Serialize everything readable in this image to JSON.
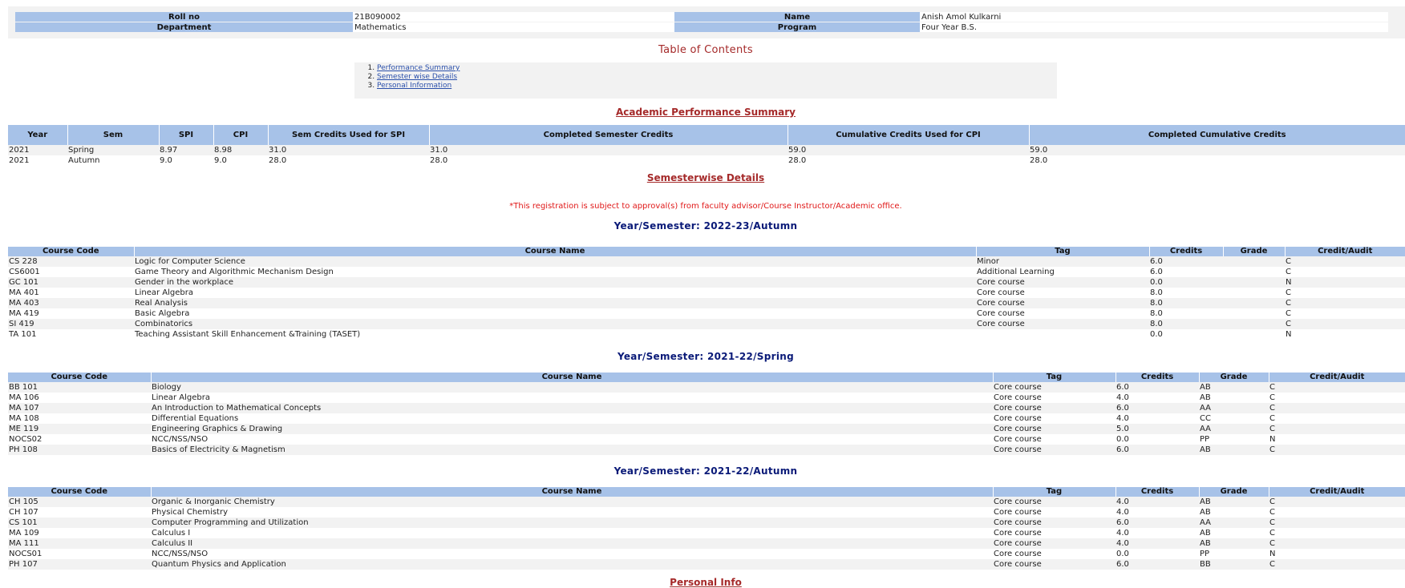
{
  "student": {
    "roll_label": "Roll no",
    "roll_value": "21B090002",
    "name_label": "Name",
    "name_value": "Anish Amol Kulkarni",
    "dept_label": "Department",
    "dept_value": "Mathematics",
    "program_label": "Program",
    "program_value": "Four Year B.S."
  },
  "toc": {
    "title": "Table of Contents",
    "items": [
      "Performance Summary",
      "Semester wise Details",
      "Personal Information"
    ]
  },
  "performance": {
    "title": "Academic Performance Summary",
    "headers": [
      "Year",
      "Sem",
      "SPI",
      "CPI",
      "Sem Credits Used for SPI",
      "Completed Semester Credits",
      "Cumulative Credits Used for CPI",
      "Completed Cumulative Credits"
    ],
    "rows": [
      [
        "2021",
        "Spring",
        "8.97",
        "8.98",
        "31.0",
        "31.0",
        "59.0",
        "59.0"
      ],
      [
        "2021",
        "Autumn",
        "9.0",
        "9.0",
        "28.0",
        "28.0",
        "28.0",
        "28.0"
      ]
    ]
  },
  "semesterwise": {
    "title": "Semesterwise Details",
    "note": "*This registration is subject to approval(s) from faculty advisor/Course Instructor/Academic office.",
    "headers": [
      "Course Code",
      "Course Name",
      "Tag",
      "Credits",
      "Grade",
      "Credit/Audit"
    ],
    "semesters": [
      {
        "title": "Year/Semester: 2022-23/Autumn",
        "rows": [
          [
            "CS 228",
            "Logic for Computer Science",
            "Minor",
            "6.0",
            "",
            "C"
          ],
          [
            "CS6001",
            "Game Theory and Algorithmic Mechanism Design",
            "Additional Learning",
            "6.0",
            "",
            "C"
          ],
          [
            "GC 101",
            "Gender in the workplace",
            "Core course",
            "0.0",
            "",
            "N"
          ],
          [
            "MA 401",
            "Linear Algebra",
            "Core course",
            "8.0",
            "",
            "C"
          ],
          [
            "MA 403",
            "Real Analysis",
            "Core course",
            "8.0",
            "",
            "C"
          ],
          [
            "MA 419",
            "Basic Algebra",
            "Core course",
            "8.0",
            "",
            "C"
          ],
          [
            "SI 419",
            "Combinatorics",
            "Core course",
            "8.0",
            "",
            "C"
          ],
          [
            "TA 101",
            "Teaching Assistant Skill Enhancement &Training (TASET)",
            "",
            "0.0",
            "",
            "N"
          ]
        ]
      },
      {
        "title": "Year/Semester: 2021-22/Spring",
        "rows": [
          [
            "BB 101",
            "Biology",
            "Core course",
            "6.0",
            "AB",
            "C"
          ],
          [
            "MA 106",
            "Linear Algebra",
            "Core course",
            "4.0",
            "AB",
            "C"
          ],
          [
            "MA 107",
            "An Introduction to Mathematical Concepts",
            "Core course",
            "6.0",
            "AA",
            "C"
          ],
          [
            "MA 108",
            "Differential Equations",
            "Core course",
            "4.0",
            "CC",
            "C"
          ],
          [
            "ME 119",
            "Engineering Graphics & Drawing",
            "Core course",
            "5.0",
            "AA",
            "C"
          ],
          [
            "NOCS02",
            "NCC/NSS/NSO",
            "Core course",
            "0.0",
            "PP",
            "N"
          ],
          [
            "PH 108",
            "Basics of Electricity & Magnetism",
            "Core course",
            "6.0",
            "AB",
            "C"
          ]
        ]
      },
      {
        "title": "Year/Semester: 2021-22/Autumn",
        "rows": [
          [
            "CH 105",
            "Organic & Inorganic Chemistry",
            "Core course",
            "4.0",
            "AB",
            "C"
          ],
          [
            "CH 107",
            "Physical Chemistry",
            "Core course",
            "4.0",
            "AB",
            "C"
          ],
          [
            "CS 101",
            "Computer Programming and Utilization",
            "Core course",
            "6.0",
            "AA",
            "C"
          ],
          [
            "MA 109",
            "Calculus I",
            "Core course",
            "4.0",
            "AB",
            "C"
          ],
          [
            "MA 111",
            "Calculus II",
            "Core course",
            "4.0",
            "AB",
            "C"
          ],
          [
            "NOCS01",
            "NCC/NSS/NSO",
            "Core course",
            "0.0",
            "PP",
            "N"
          ],
          [
            "PH 107",
            "Quantum Physics and Application",
            "Core course",
            "6.0",
            "BB",
            "C"
          ]
        ]
      }
    ]
  },
  "personal": {
    "title": "Personal Info"
  }
}
